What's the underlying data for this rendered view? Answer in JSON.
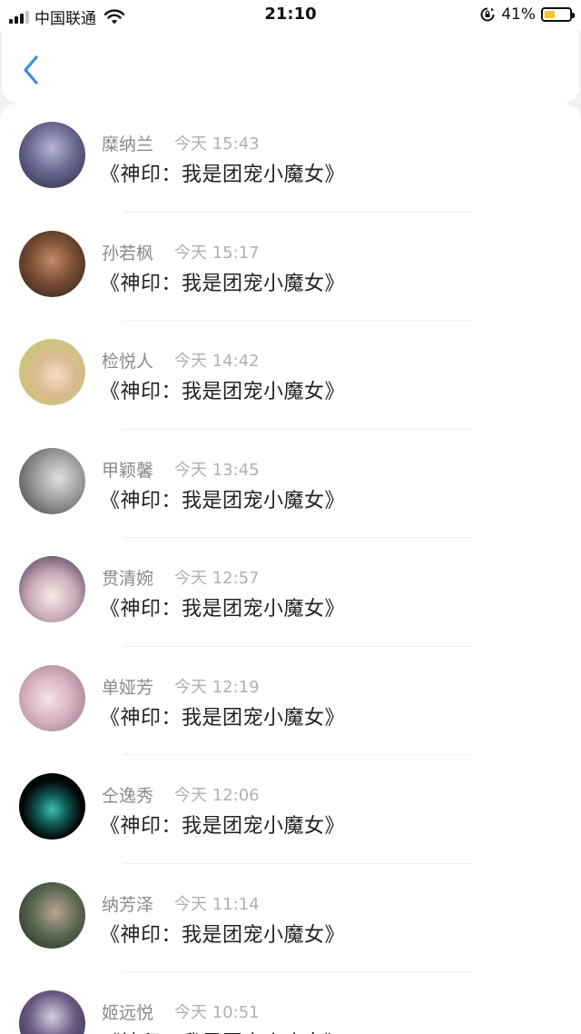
{
  "status_bar": {
    "carrier": "中国联通",
    "time": "21:10",
    "battery": "41%",
    "battery_level": 0.41
  },
  "nav": {
    "back_icon": "chevron-left-icon"
  },
  "messages": [
    {
      "name": "糜纳兰",
      "time": "今天 15:43",
      "text": "《神印：我是团宠小魔女》"
    },
    {
      "name": "孙若枫",
      "time": "今天 15:17",
      "text": "《神印：我是团宠小魔女》"
    },
    {
      "name": "检悦人",
      "time": "今天 14:42",
      "text": "《神印：我是团宠小魔女》"
    },
    {
      "name": "甲颖馨",
      "time": "今天 13:45",
      "text": "《神印：我是团宠小魔女》"
    },
    {
      "name": "贯清婉",
      "time": "今天 12:57",
      "text": "《神印：我是团宠小魔女》"
    },
    {
      "name": "单娅芳",
      "time": "今天 12:19",
      "text": "《神印：我是团宠小魔女》"
    },
    {
      "name": "仝逸秀",
      "time": "今天 12:06",
      "text": "《神印：我是团宠小魔女》"
    },
    {
      "name": "纳芳泽",
      "time": "今天 11:14",
      "text": "《神印：我是团宠小魔女》"
    },
    {
      "name": "姬远悦",
      "time": "今天 10:51",
      "text": "《神印：我是团宠小魔女》"
    }
  ],
  "colors": {
    "accent": "#3a8ee6",
    "name": "#8a8a8a",
    "time": "#b0b0b0",
    "text": "#222222",
    "battery": "#f3c631"
  }
}
